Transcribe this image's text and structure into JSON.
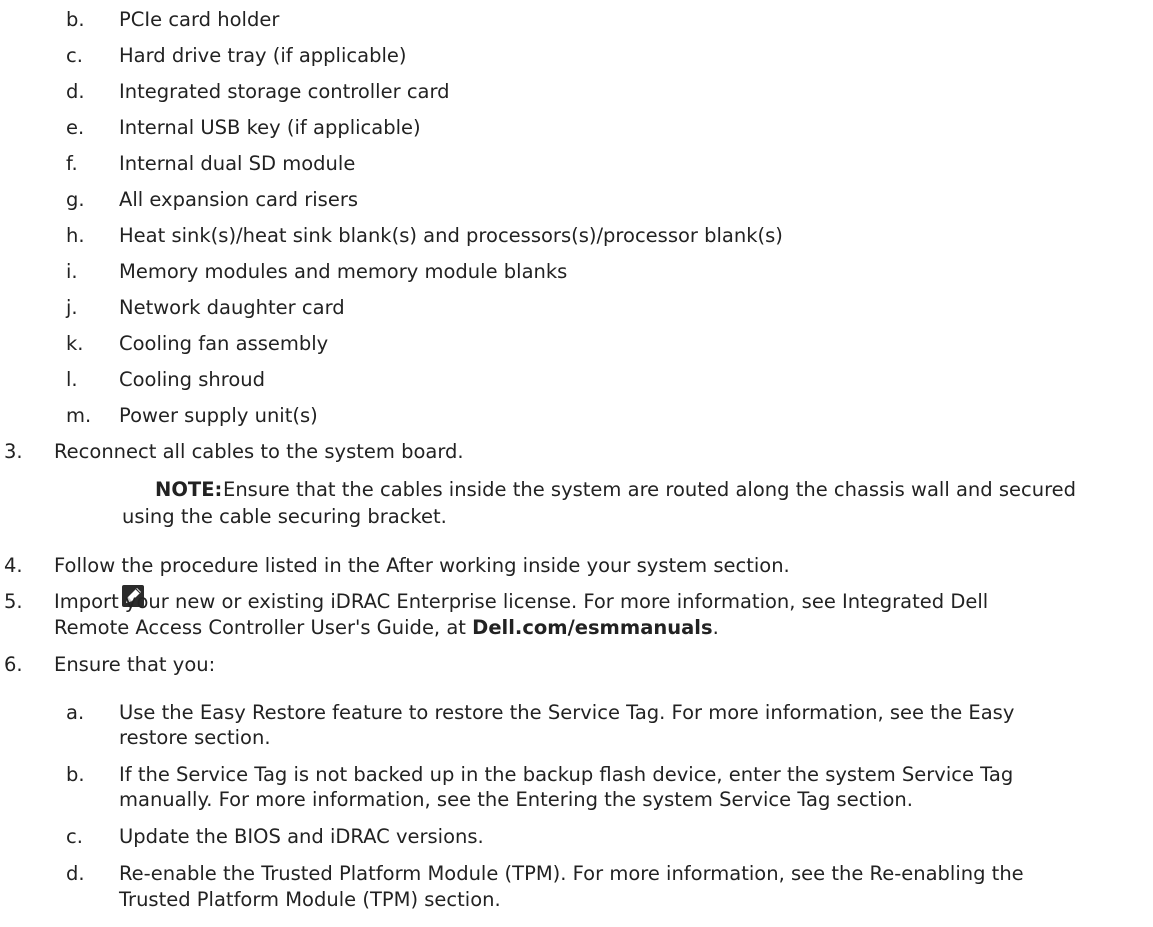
{
  "sub_a": [
    {
      "label": "b.",
      "text": "PCIe card holder"
    },
    {
      "label": "c.",
      "text": "Hard drive tray (if applicable)"
    },
    {
      "label": "d.",
      "text": "Integrated storage controller card"
    },
    {
      "label": "e.",
      "text": "Internal USB key (if applicable)"
    },
    {
      "label": "f.",
      "text": "Internal dual SD module"
    },
    {
      "label": "g.",
      "text": "All expansion card risers"
    },
    {
      "label": "h.",
      "text": "Heat sink(s)/heat sink blank(s) and processors(s)/processor blank(s)"
    },
    {
      "label": "i.",
      "text": "Memory modules and memory module blanks"
    },
    {
      "label": "j.",
      "text": "Network daughter card"
    },
    {
      "label": "k.",
      "text": "Cooling fan assembly"
    },
    {
      "label": "l.",
      "text": "Cooling shroud"
    },
    {
      "label": "m.",
      "text": "Power supply unit(s)"
    }
  ],
  "step3": {
    "label": "3.",
    "text": "Reconnect all cables to the system board."
  },
  "note": {
    "label": "NOTE:",
    "line1": "Ensure that the cables inside the system are routed along the chassis wall and secured",
    "line2": "using the cable securing bracket."
  },
  "step4": {
    "label": "4.",
    "text": "Follow the procedure listed in the After working inside your system section."
  },
  "step5": {
    "label": "5.",
    "line1": "Import your new or existing iDRAC Enterprise license. For more information, see Integrated Dell",
    "line2": "Remote Access Controller User's Guide, at ",
    "link": "Dell.com/esmmanuals",
    "end": "."
  },
  "step6": {
    "label": "6.",
    "text": "Ensure that you:"
  },
  "sub_b": [
    {
      "label": "a.",
      "line1": "Use the Easy Restore feature to restore the Service Tag. For more information, see the Easy",
      "line2": "restore section."
    },
    {
      "label": "b.",
      "line1": "If the Service Tag is not backed up in the backup flash device, enter the system Service Tag",
      "line2": "manually. For more information, see the Entering the system Service Tag section."
    },
    {
      "label": "c.",
      "line1": "Update the BIOS and iDRAC versions.",
      "line2": ""
    },
    {
      "label": "d.",
      "line1": "Re-enable the Trusted Platform Module (TPM). For more information, see the Re-enabling the",
      "line2": "Trusted Platform Module (TPM) section."
    }
  ]
}
